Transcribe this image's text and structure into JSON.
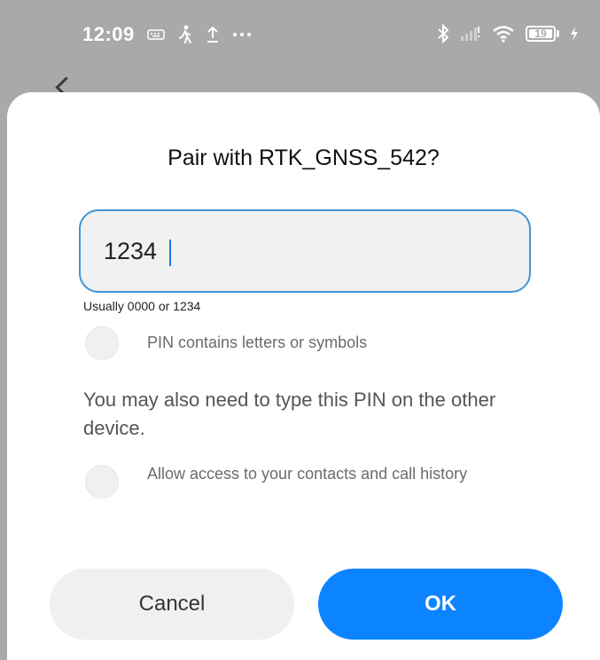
{
  "status_bar": {
    "time": "12:09",
    "battery_level": "19",
    "left_icons": [
      "keyboard-icon",
      "walking-icon",
      "upload-icon",
      "more-icon"
    ],
    "right_icons": [
      "bluetooth-icon",
      "cellular-signal-icon",
      "wifi-icon",
      "battery-icon",
      "charging-icon"
    ]
  },
  "dialog": {
    "title": "Pair with RTK_GNSS_542?",
    "pin_value": "1234",
    "pin_hint": "Usually 0000 or 1234",
    "letters_option": "PIN contains letters or symbols",
    "info_text": "You may also need to type this PIN on the other device.",
    "contacts_option": "Allow access to your contacts and call history",
    "cancel_label": "Cancel",
    "ok_label": "OK"
  },
  "colors": {
    "overlay": "#a9a9a9",
    "accent": "#0d84ff",
    "field_border": "#3f95d6",
    "field_bg": "#f1f1f1"
  }
}
